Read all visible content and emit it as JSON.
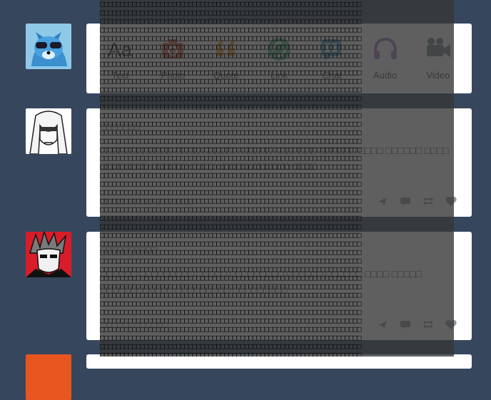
{
  "composer": {
    "types": [
      {
        "key": "text",
        "label": "Text",
        "color": "#444444",
        "icon": "text-icon"
      },
      {
        "key": "photo",
        "label": "Photo",
        "color": "#d95e40",
        "icon": "camera-icon"
      },
      {
        "key": "quote",
        "label": "Quote",
        "color": "#f2992e",
        "icon": "quote-icon"
      },
      {
        "key": "link",
        "label": "Link",
        "color": "#56bc8a",
        "icon": "link-icon"
      },
      {
        "key": "chat",
        "label": "Chat",
        "color": "#529ecc",
        "icon": "chat-icon"
      },
      {
        "key": "audio",
        "label": "Audio",
        "color": "#a77dc2",
        "icon": "headphones-icon"
      },
      {
        "key": "video",
        "label": "Video",
        "color": "#748089",
        "icon": "video-camera-icon"
      }
    ]
  },
  "posts": [
    {
      "author": "□□□□□□□",
      "body": "□□□□□□□□□□□□ □□□□ □□□□□□ □□□□□ □□□□□□□ □□□□□□ □□□□ □□□□□□ □□□□ □□□□□□□□ □□□□□□ □□□□ □□□□□□□□□□□□ □□□□",
      "notes": "□□□□□□□□□ □□□□□□□",
      "colors": {
        "reblog": "#8e959d",
        "like": "#8e959d"
      }
    },
    {
      "author": "□□□□□□□□□□",
      "body": "□□□□□□ □□□□□□□□□ □□□□□ □□□□□□□□□ □□□□□□ □□□□□□ □□□□ □□□□□ □□□□□□□□□□□□ □□□□□□□□□ □□□□□□□□□",
      "notes": "□□□□□□□□□□□□",
      "colors": {
        "reblog": "#8e959d",
        "like": "#8e959d"
      }
    }
  ],
  "overlay": {
    "lines": [
      "□□□□□□□□□□□□□□□□□□□□□□□□□□□□□□□□□□□□□□□□□□□□□□□□□□□□□□□□□□□□□□□□□",
      "□□□□□□□□□□□□□□□□□□□□□□□□□□□□□□□□□□□□□□□□□□□□□□□□□□□□□□□□□□□□□□□□□"
    ]
  }
}
